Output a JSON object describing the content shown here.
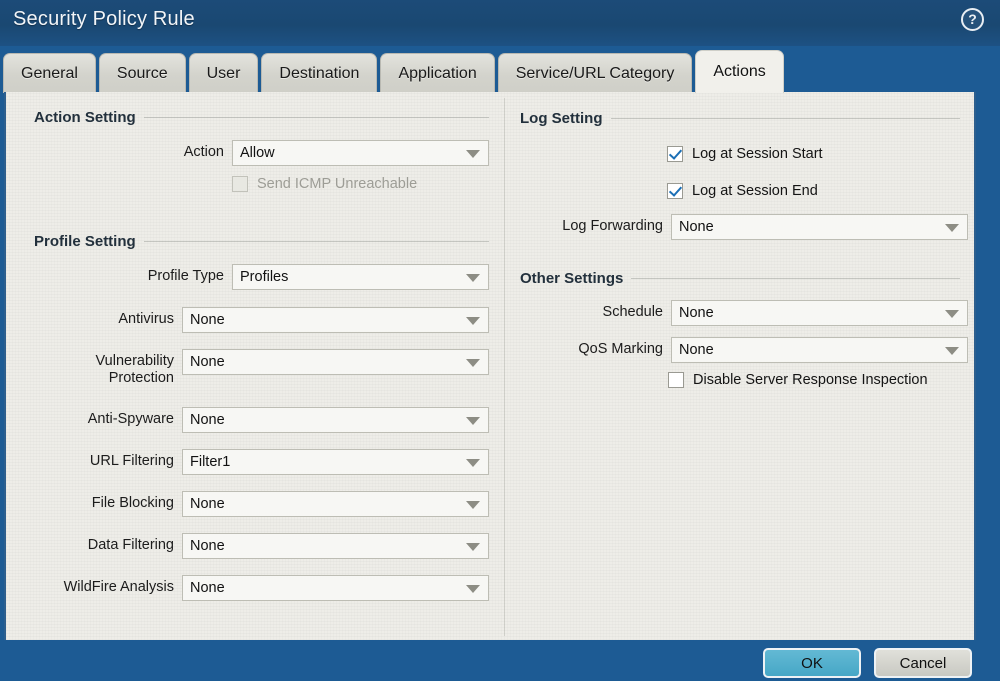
{
  "window": {
    "title": "Security Policy Rule",
    "help_icon": "help-circle-icon",
    "help_glyph": "?"
  },
  "tabs": [
    {
      "label": "General",
      "active": false
    },
    {
      "label": "Source",
      "active": false
    },
    {
      "label": "User",
      "active": false
    },
    {
      "label": "Destination",
      "active": false
    },
    {
      "label": "Application",
      "active": false
    },
    {
      "label": "Service/URL Category",
      "active": false
    },
    {
      "label": "Actions",
      "active": true
    }
  ],
  "left_column": {
    "action_setting": {
      "heading": "Action Setting",
      "action": {
        "label": "Action",
        "value": "Allow"
      },
      "send_icmp_unreachable": {
        "label": "Send ICMP Unreachable",
        "checked": false,
        "disabled": true
      }
    },
    "profile_setting": {
      "heading": "Profile Setting",
      "fields": [
        {
          "label": "Profile Type",
          "value": "Profiles"
        },
        {
          "label": "Antivirus",
          "value": "None"
        },
        {
          "label": "Vulnerability\nProtection",
          "value": "None"
        },
        {
          "label": "Anti-Spyware",
          "value": "None"
        },
        {
          "label": "URL Filtering",
          "value": "Filter1"
        },
        {
          "label": "File Blocking",
          "value": "None"
        },
        {
          "label": "Data Filtering",
          "value": "None"
        },
        {
          "label": "WildFire Analysis",
          "value": "None"
        }
      ]
    }
  },
  "right_column": {
    "log_setting": {
      "heading": "Log Setting",
      "log_at_session_start": {
        "label": "Log at Session Start",
        "checked": true
      },
      "log_at_session_end": {
        "label": "Log at Session End",
        "checked": true
      },
      "log_forwarding": {
        "label": "Log Forwarding",
        "value": "None"
      }
    },
    "other_settings": {
      "heading": "Other Settings",
      "schedule": {
        "label": "Schedule",
        "value": "None"
      },
      "qos_marking": {
        "label": "QoS Marking",
        "value": "None"
      },
      "disable_server_response_inspection": {
        "label": "Disable Server Response Inspection",
        "checked": false
      }
    }
  },
  "footer": {
    "ok_label": "OK",
    "cancel_label": "Cancel"
  },
  "colors": {
    "titlebar": "#1a4872",
    "footer": "#1d5b94",
    "content_bg": "#eeede8",
    "active_tab": "#f1f0eb",
    "inactive_tab": "#d3d3cc",
    "ok_button": "#46a7c6",
    "cancel_button": "#c9c9c2",
    "checkmark": "#1b6fb5"
  }
}
